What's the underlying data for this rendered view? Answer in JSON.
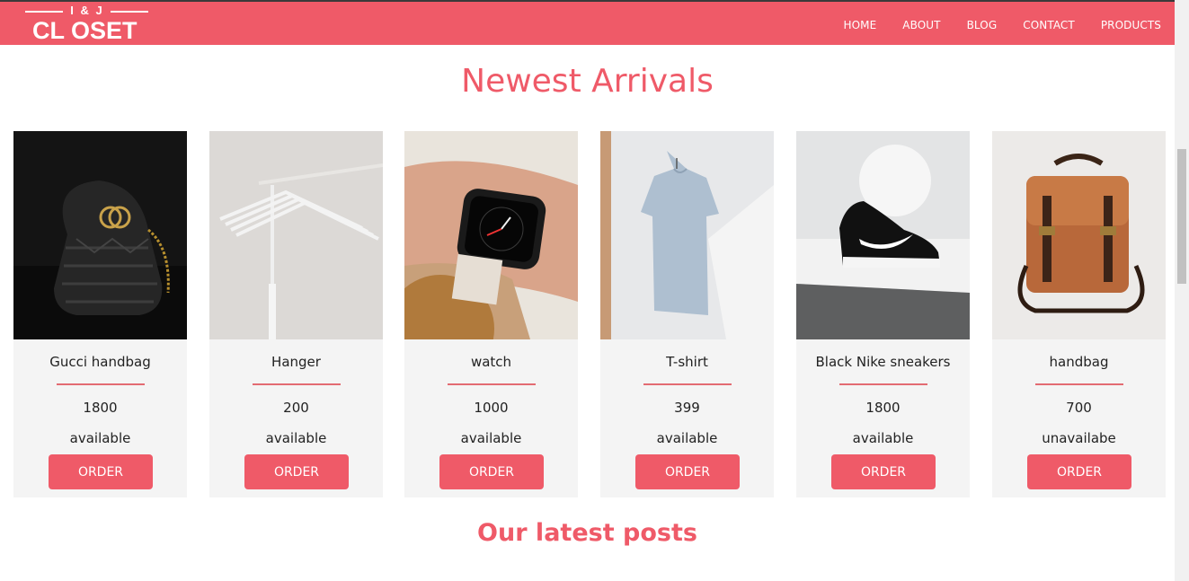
{
  "brand": {
    "logo_top": "I & J",
    "logo_main": "CL OSET",
    "accent": "#ef5a68"
  },
  "nav": {
    "items": [
      {
        "label": "HOME"
      },
      {
        "label": "ABOUT"
      },
      {
        "label": "BLOG"
      },
      {
        "label": "CONTACT"
      },
      {
        "label": "PRODUCTS"
      }
    ]
  },
  "sections": {
    "newest_title": "Newest Arrivals",
    "posts_title": "Our latest posts"
  },
  "products": [
    {
      "name": "Gucci handbag",
      "price": "1800",
      "status": "available",
      "button": "ORDER",
      "image": "gucci-handbag-photo"
    },
    {
      "name": "Hanger",
      "price": "200",
      "status": "available",
      "button": "ORDER",
      "image": "hanger-photo"
    },
    {
      "name": "watch",
      "price": "1000",
      "status": "available",
      "button": "ORDER",
      "image": "watch-photo"
    },
    {
      "name": "T-shirt",
      "price": "399",
      "status": "available",
      "button": "ORDER",
      "image": "t-shirt-photo"
    },
    {
      "name": "Black Nike sneakers",
      "price": "1800",
      "status": "available",
      "button": "ORDER",
      "image": "sneakers-photo"
    },
    {
      "name": "handbag",
      "price": "700",
      "status": "unavailabe",
      "button": "ORDER",
      "image": "backpack-photo"
    }
  ]
}
